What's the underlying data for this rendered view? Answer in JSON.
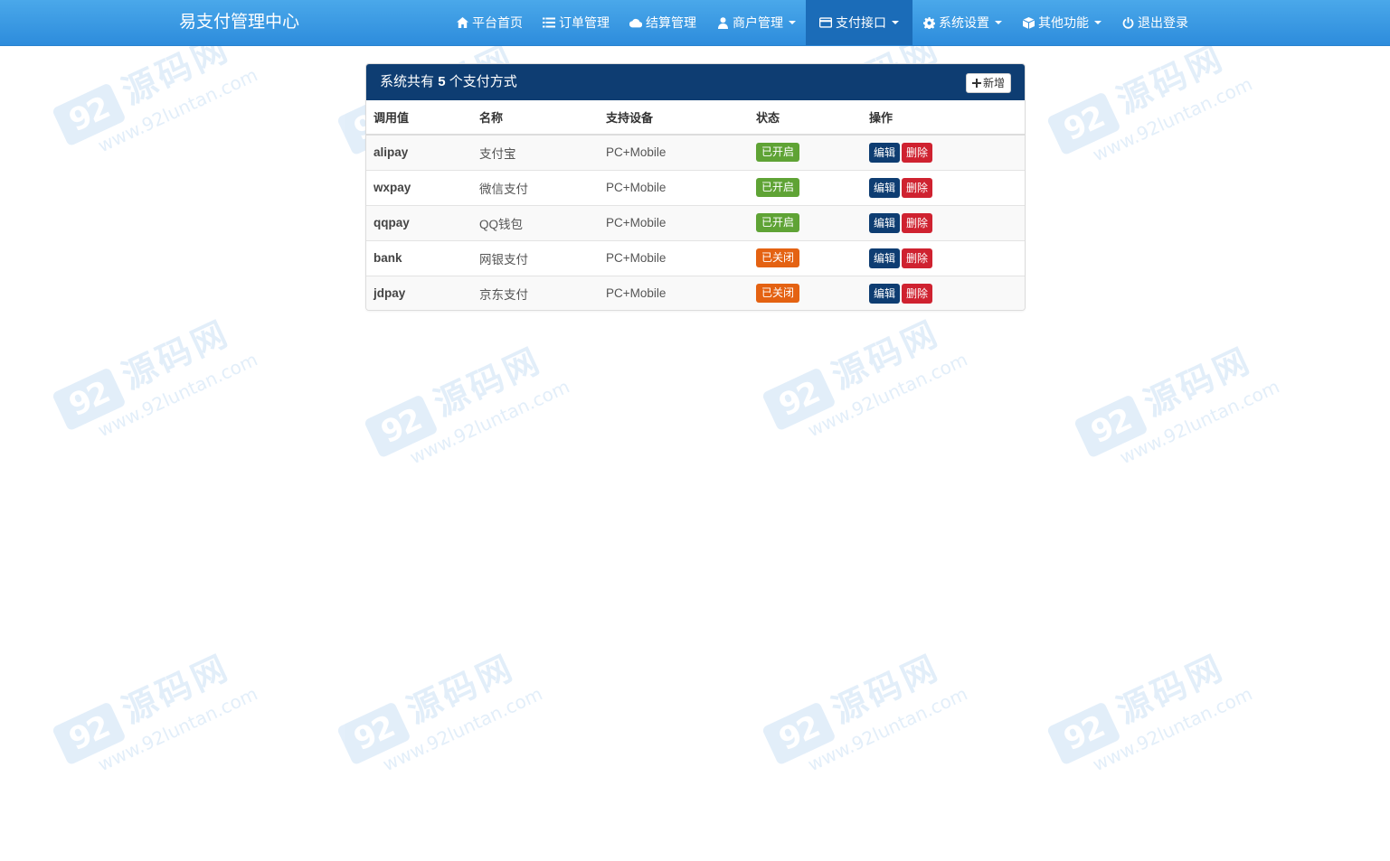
{
  "navbar": {
    "brand": "易支付管理中心",
    "items": [
      {
        "label": "平台首页",
        "icon": "home-icon",
        "dropdown": false,
        "active": false
      },
      {
        "label": "订单管理",
        "icon": "list-icon",
        "dropdown": false,
        "active": false
      },
      {
        "label": "结算管理",
        "icon": "cloud-icon",
        "dropdown": false,
        "active": false
      },
      {
        "label": "商户管理",
        "icon": "user-icon",
        "dropdown": true,
        "active": false
      },
      {
        "label": "支付接口",
        "icon": "credit-card-icon",
        "dropdown": true,
        "active": true
      },
      {
        "label": "系统设置",
        "icon": "gear-icon",
        "dropdown": true,
        "active": false
      },
      {
        "label": "其他功能",
        "icon": "cube-icon",
        "dropdown": true,
        "active": false
      },
      {
        "label": "退出登录",
        "icon": "power-icon",
        "dropdown": false,
        "active": false
      }
    ]
  },
  "panel": {
    "title_prefix": "系统共有",
    "count": "5",
    "title_suffix": "个支付方式",
    "add_label": "新增"
  },
  "table": {
    "headers": [
      "调用值",
      "名称",
      "支持设备",
      "状态",
      "操作"
    ],
    "edit_label": "编辑",
    "delete_label": "删除",
    "rows": [
      {
        "code": "alipay",
        "name": "支付宝",
        "device": "PC+Mobile",
        "status": "已开启",
        "enabled": true
      },
      {
        "code": "wxpay",
        "name": "微信支付",
        "device": "PC+Mobile",
        "status": "已开启",
        "enabled": true
      },
      {
        "code": "qqpay",
        "name": "QQ钱包",
        "device": "PC+Mobile",
        "status": "已开启",
        "enabled": true
      },
      {
        "code": "bank",
        "name": "网银支付",
        "device": "PC+Mobile",
        "status": "已关闭",
        "enabled": false
      },
      {
        "code": "jdpay",
        "name": "京东支付",
        "device": "PC+Mobile",
        "status": "已关闭",
        "enabled": false
      }
    ]
  },
  "watermark": {
    "logo": "92",
    "cn": "源码网",
    "url": "www.92luntan.com"
  },
  "colors": {
    "navbar": "#3498e2",
    "panel_heading": "#0e3d72",
    "status_on": "#5fa335",
    "status_off": "#e46212",
    "edit": "#0e3d72",
    "delete": "#cf2230"
  }
}
